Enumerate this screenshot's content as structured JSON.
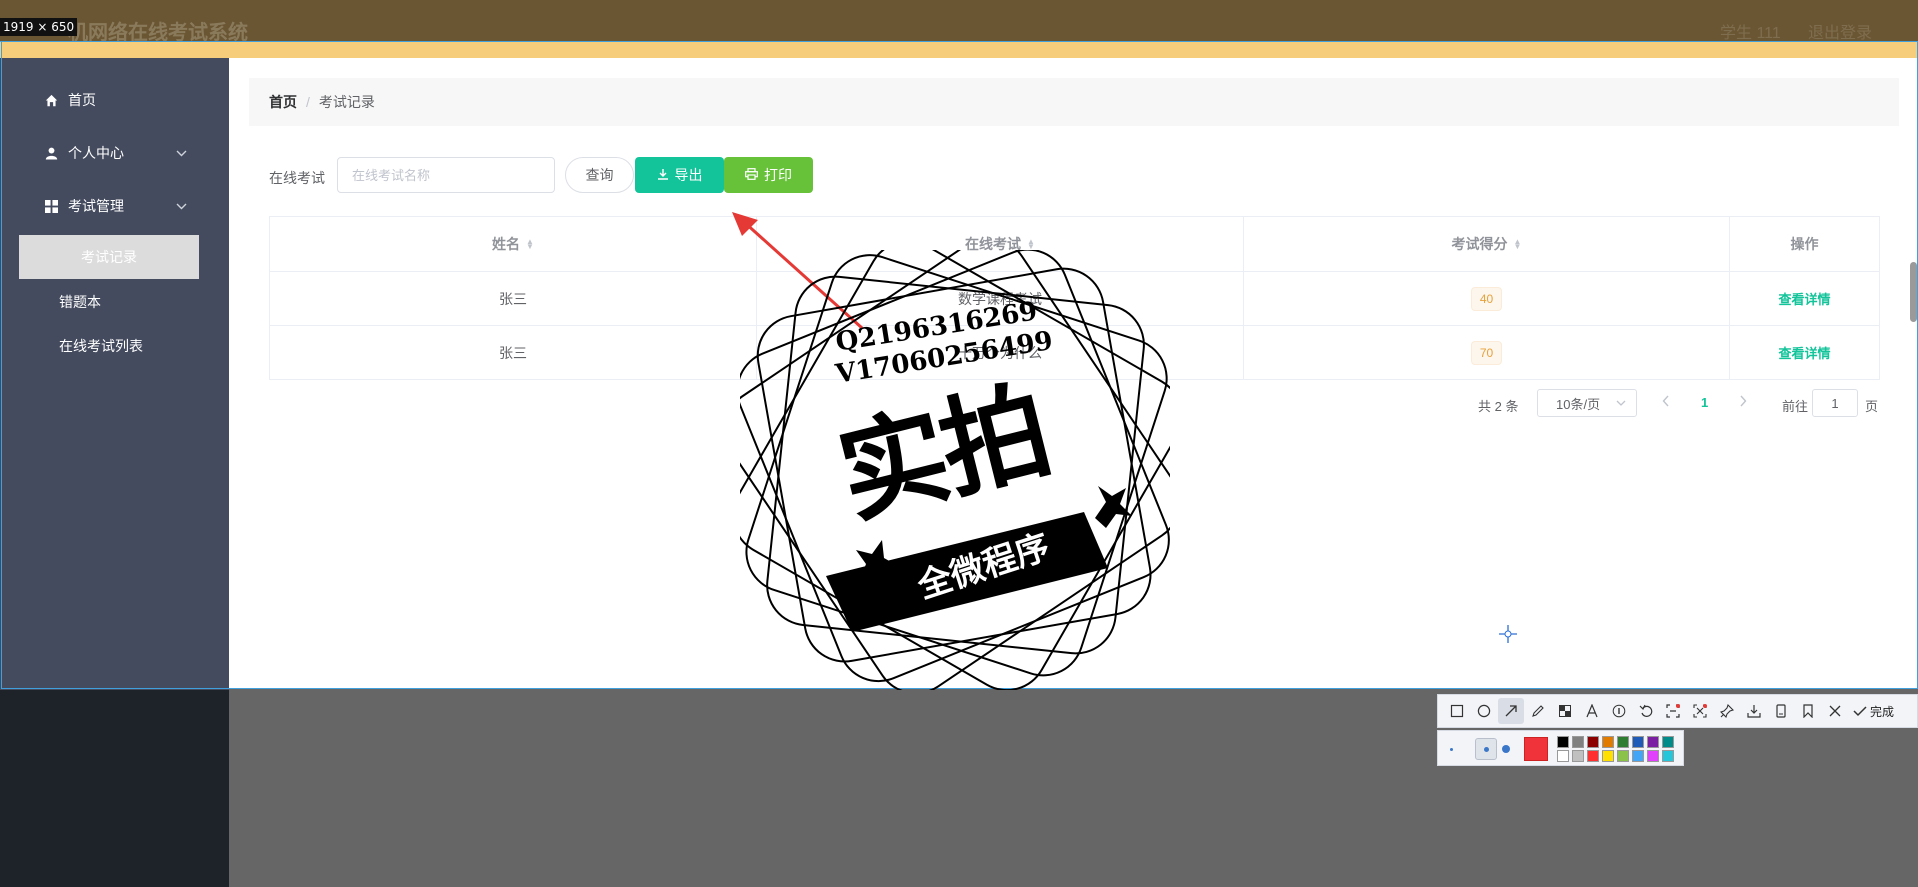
{
  "size_tag": "1919 × 650",
  "header": {
    "title": "机网络在线考试系统",
    "user": "学生 111",
    "logout": "退出登录"
  },
  "sidebar": {
    "items": [
      {
        "label": "首页",
        "icon": "home-icon"
      },
      {
        "label": "个人中心",
        "icon": "user-icon",
        "chevron": "⌄"
      },
      {
        "label": "考试管理",
        "icon": "grid-icon",
        "chevron": "⌄"
      }
    ],
    "sub_items": [
      "考试记录",
      "错题本",
      "在线考试列表"
    ]
  },
  "breadcrumb": {
    "home": "首页",
    "separator": "/",
    "current": "考试记录"
  },
  "search": {
    "label": "在线考试",
    "placeholder": "在线考试名称",
    "query_button": "查询",
    "export_button": "导出",
    "print_button": "打印"
  },
  "table": {
    "headers": [
      "姓名",
      "在线考试",
      "考试得分",
      "操作"
    ],
    "rows": [
      {
        "name": "张三",
        "exam": "数学课程考试",
        "score": "40",
        "action": "查看详情"
      },
      {
        "name": "张三",
        "exam": "十万个为什么",
        "score": "70",
        "action": "查看详情"
      }
    ]
  },
  "pagination": {
    "total": "共 2 条",
    "page_size": "10条/页",
    "current_page": "1",
    "goto_label": "前往",
    "goto_value": "1",
    "page_unit": "页"
  },
  "watermark": {
    "line1": "Q2196316269",
    "line2": "V17060256499",
    "big": "实拍",
    "banner": "全微程序"
  },
  "toolbar": {
    "done_label": "完成",
    "tools": [
      "rect-icon",
      "ellipse-icon",
      "arrow-icon",
      "pen-icon",
      "mosaic-icon",
      "text-icon",
      "number-icon",
      "undo-icon",
      "ocr-icon",
      "scan-icon",
      "pin-icon",
      "download-icon",
      "save-icon",
      "bookmark-icon",
      "close-icon",
      "check-icon"
    ],
    "current_color": "#f0333a",
    "swatches": [
      "#000000",
      "#808080",
      "#8b0000",
      "#e07b00",
      "#2e7d32",
      "#1e5bb8",
      "#7b1fa2",
      "#008b8b",
      "#ffffff",
      "#c0c0c0",
      "#ff3030",
      "#ffe000",
      "#8bc34a",
      "#42a5f5",
      "#e040fb",
      "#26c6da"
    ]
  },
  "colors": {
    "accent": "#13c49a",
    "print": "#67c23a",
    "sidebar": "#444b5e"
  }
}
